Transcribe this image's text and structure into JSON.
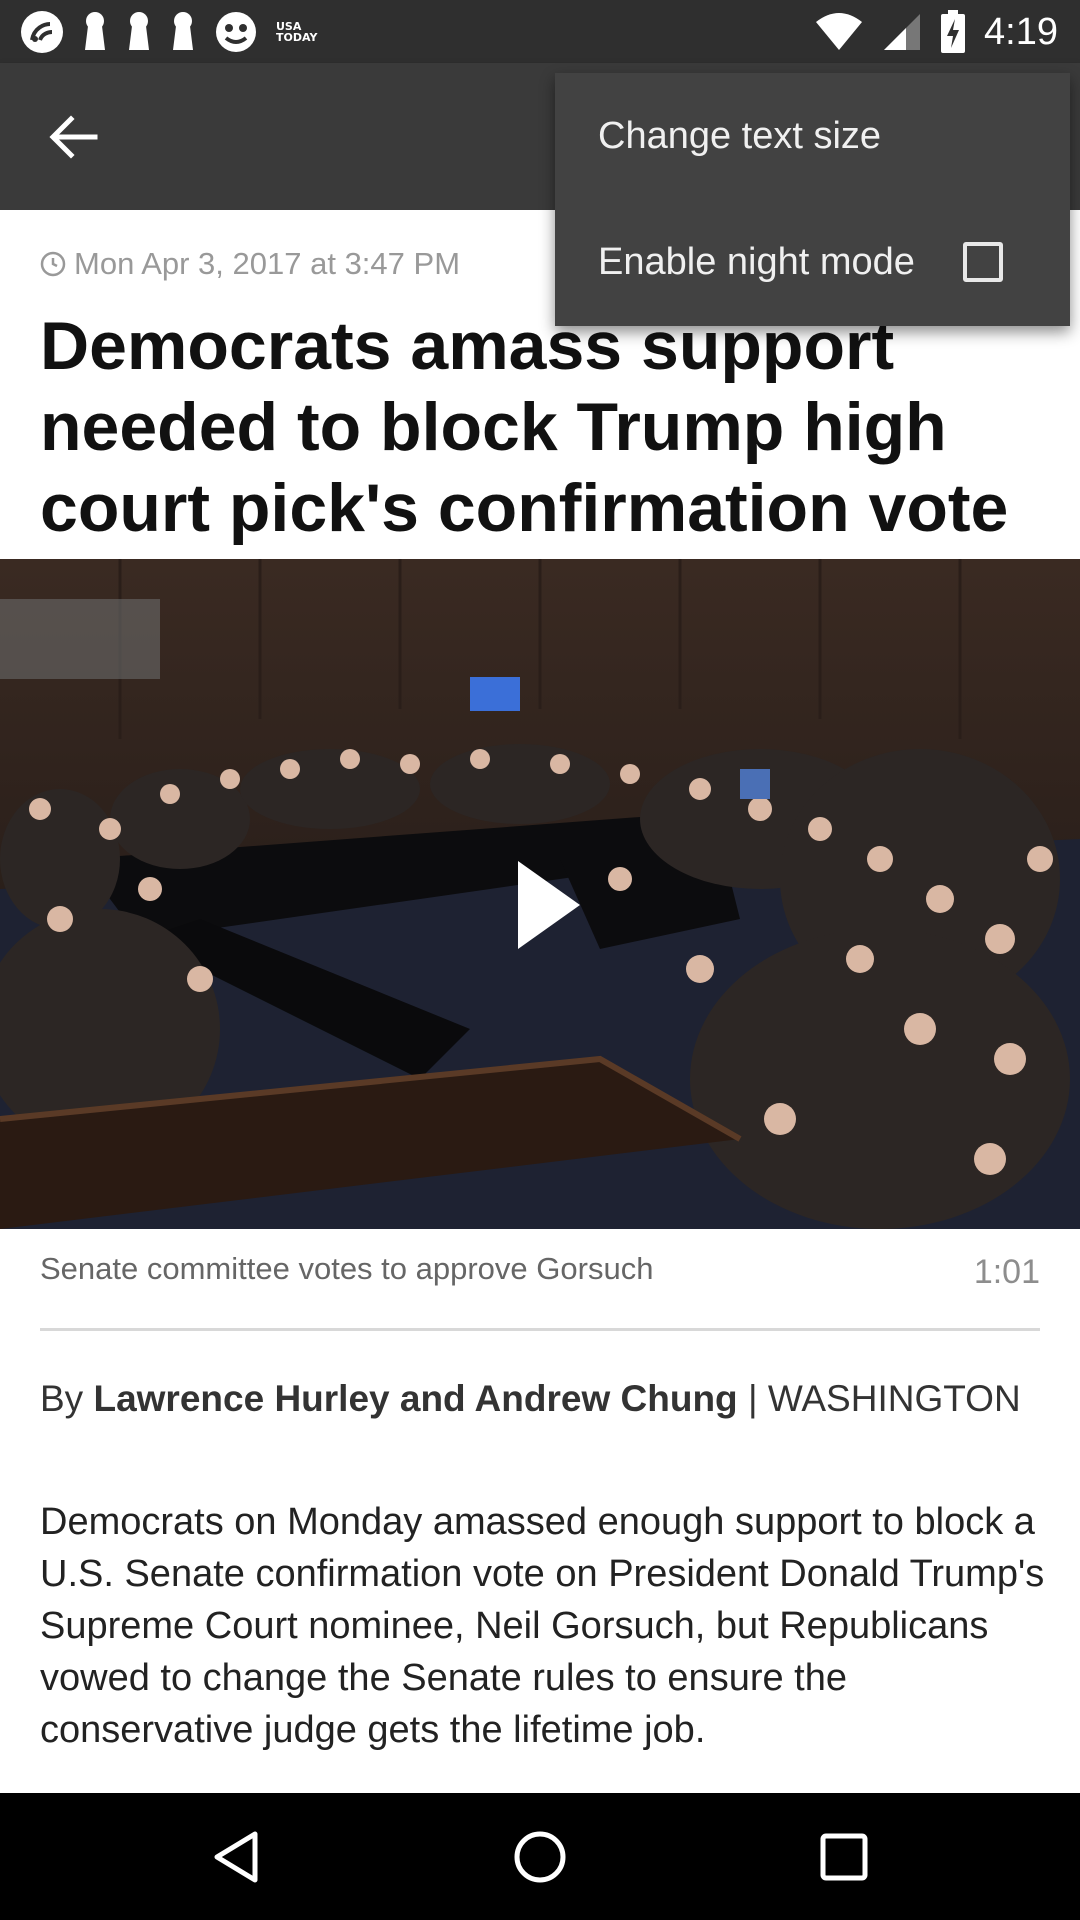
{
  "status_bar": {
    "time": "4:19",
    "left_icons": [
      "app-notification-icon",
      "keyhole-icon",
      "keyhole-icon",
      "keyhole-icon",
      "face-icon",
      "usa-today-icon"
    ],
    "usa_today_line1": "USA",
    "usa_today_line2": "TODAY",
    "right_icons": [
      "wifi-icon",
      "signal-icon",
      "battery-charging-icon"
    ]
  },
  "app_bar": {
    "back_icon": "arrow-left-icon"
  },
  "overflow_menu": {
    "items": [
      {
        "label": "Change text size"
      },
      {
        "label": "Enable night mode",
        "checked": false
      }
    ]
  },
  "article": {
    "timestamp": "Mon Apr 3, 2017 at 3:47 PM",
    "headline": "Democrats amass support needed to block Trump high court pick's confirmation vote",
    "video": {
      "caption": "Senate committee votes to approve Gorsuch",
      "duration": "1:01",
      "play_icon": "play-icon"
    },
    "byline_prefix": "By",
    "byline_authors": "Lawrence Hurley and Andrew Chung",
    "byline_location": "| WASHINGTON",
    "body": "Democrats on Monday amassed enough support to block a U.S. Senate confirmation vote on President Donald Trump's Supreme Court nominee, Neil Gorsuch, but Republicans vowed to change the Senate rules to ensure the conservative judge gets the lifetime job."
  },
  "nav_bar": {
    "buttons": [
      "back-triangle-icon",
      "home-circle-icon",
      "recents-square-icon"
    ]
  }
}
